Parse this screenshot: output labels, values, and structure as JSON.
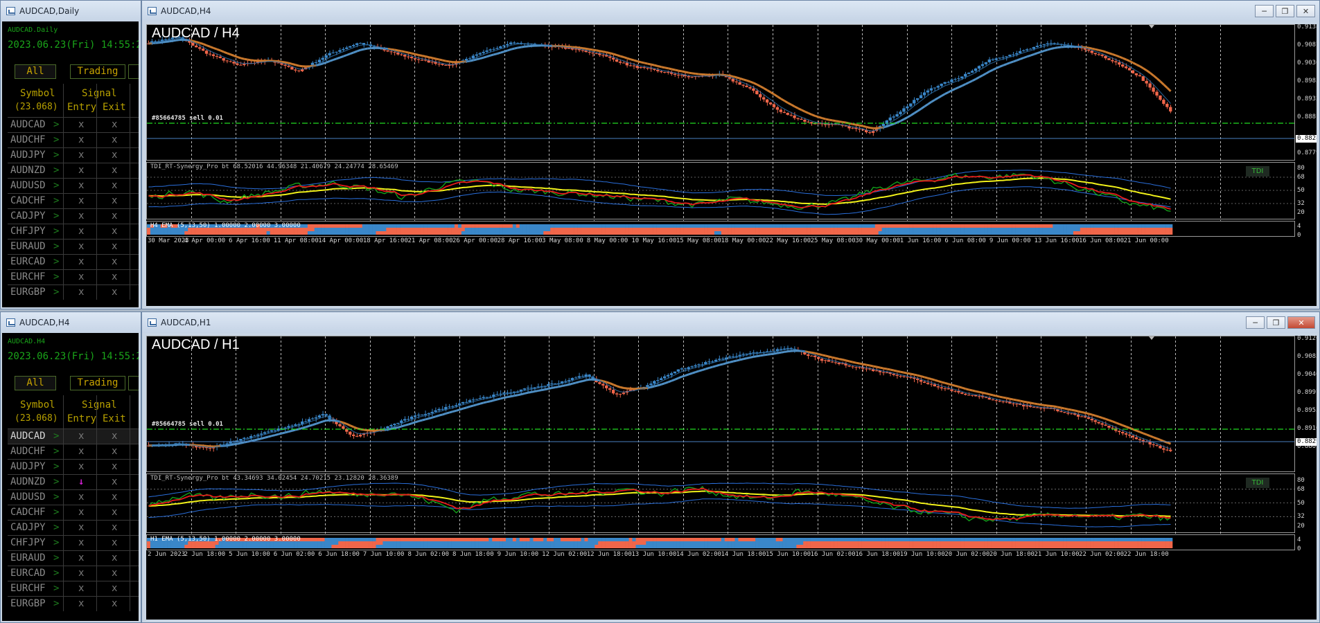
{
  "colors": {
    "bull": "#3a87c9",
    "bear": "#f0664a",
    "ema_fast": "#c9782c",
    "ema_slow": "#4f8fc4",
    "tdi_green": "#14a01a",
    "tdi_red": "#e81b1b",
    "tdi_yellow": "#f2f21a",
    "tdi_band": "#2a6fdc",
    "order_line": "#22dd22"
  },
  "windows": {
    "daily": {
      "title": "AUDCAD,Daily",
      "panel_header": "AUDCAD.Daily",
      "datetime": "2023.06.23(Fri) 14:55:2"
    },
    "h4side": {
      "title": "AUDCAD,H4",
      "panel_header": "AUDCAD.H4",
      "datetime": "2023.06.23(Fri) 14:55:2"
    },
    "h4": {
      "title": "AUDCAD,H4",
      "chart_label": "AUDCAD / H4"
    },
    "h1": {
      "title": "AUDCAD,H1",
      "chart_label": "AUDCAD / H1"
    }
  },
  "window_buttons": {
    "minimize": "─",
    "restore": "❐",
    "close": "✕"
  },
  "signal_panel": {
    "tab_all": "All",
    "tab_trading": "Trading",
    "col_symbol": "Symbol",
    "col_symbol_sub": "(23.068)",
    "col_signal": "Signal",
    "col_entry": "Entry",
    "col_exit": "Exit",
    "symbols": [
      "AUDCAD",
      "AUDCHF",
      "AUDJPY",
      "AUDNZD",
      "AUDUSD",
      "CADCHF",
      "CADJPY",
      "CHFJPY",
      "EURAUD",
      "EURCAD",
      "EURCHF",
      "EURGBP"
    ],
    "gt": ">",
    "x": "x",
    "arrow": "↓"
  },
  "h4chart": {
    "order_label": "#85664785 sell 0.01",
    "tdi_label": "TDI_RT-Synergy_Pro bt 68.52016 44.96348 21.40679 24.24774 28.65469",
    "ema_label": "H4 EMA (5,13,50) 1.00000 2.00000 3.00000",
    "tdi_button": "TDI",
    "price_scale": [
      "0.91380",
      "0.90870",
      "0.90360",
      "0.89835",
      "0.89325",
      "0.88815",
      "0.88289",
      "0.87795"
    ],
    "current_price": "0.88289",
    "tdi_scale": [
      "80",
      "68",
      "50",
      "32",
      "20"
    ],
    "ema_scale": [
      "4",
      "0"
    ],
    "time_labels": [
      "30 Mar 2023",
      "4 Apr 00:00",
      "6 Apr 16:00",
      "11 Apr 08:00",
      "14 Apr 00:00",
      "18 Apr 16:00",
      "21 Apr 08:00",
      "26 Apr 00:00",
      "28 Apr 16:00",
      "3 May 08:00",
      "8 May 00:00",
      "10 May 16:00",
      "15 May 08:00",
      "18 May 00:00",
      "22 May 16:00",
      "25 May 08:00",
      "30 May 00:00",
      "1 Jun 16:00",
      "6 Jun 08:00",
      "9 Jun 00:00",
      "13 Jun 16:00",
      "16 Jun 08:00",
      "21 Jun 00:00"
    ]
  },
  "h1chart": {
    "order_label": "#85664785 sell 0.01",
    "tdi_label": "TDI_RT-Synergy_Pro bt 43.34693 34.02454 24.70215 23.12820 28.36389",
    "ema_label": "H1 EMA (5,13,50) 1.00000 2.00000 3.00000",
    "tdi_button": "TDI",
    "price_scale": [
      "0.91260",
      "0.90830",
      "0.90400",
      "0.89970",
      "0.89530",
      "0.89100",
      "0.88670",
      "0.88293"
    ],
    "current_price": "0.88293",
    "tdi_scale": [
      "80",
      "68",
      "50",
      "32",
      "20"
    ],
    "ema_scale": [
      "4",
      "0"
    ],
    "time_labels": [
      "2 Jun 2023",
      "2 Jun 18:00",
      "5 Jun 10:00",
      "6 Jun 02:00",
      "6 Jun 18:00",
      "7 Jun 10:00",
      "8 Jun 02:00",
      "8 Jun 18:00",
      "9 Jun 10:00",
      "12 Jun 02:00",
      "12 Jun 18:00",
      "13 Jun 10:00",
      "14 Jun 02:00",
      "14 Jun 18:00",
      "15 Jun 10:00",
      "16 Jun 02:00",
      "16 Jun 18:00",
      "19 Jun 10:00",
      "20 Jun 02:00",
      "20 Jun 18:00",
      "21 Jun 10:00",
      "22 Jun 02:00",
      "22 Jun 18:00"
    ]
  }
}
